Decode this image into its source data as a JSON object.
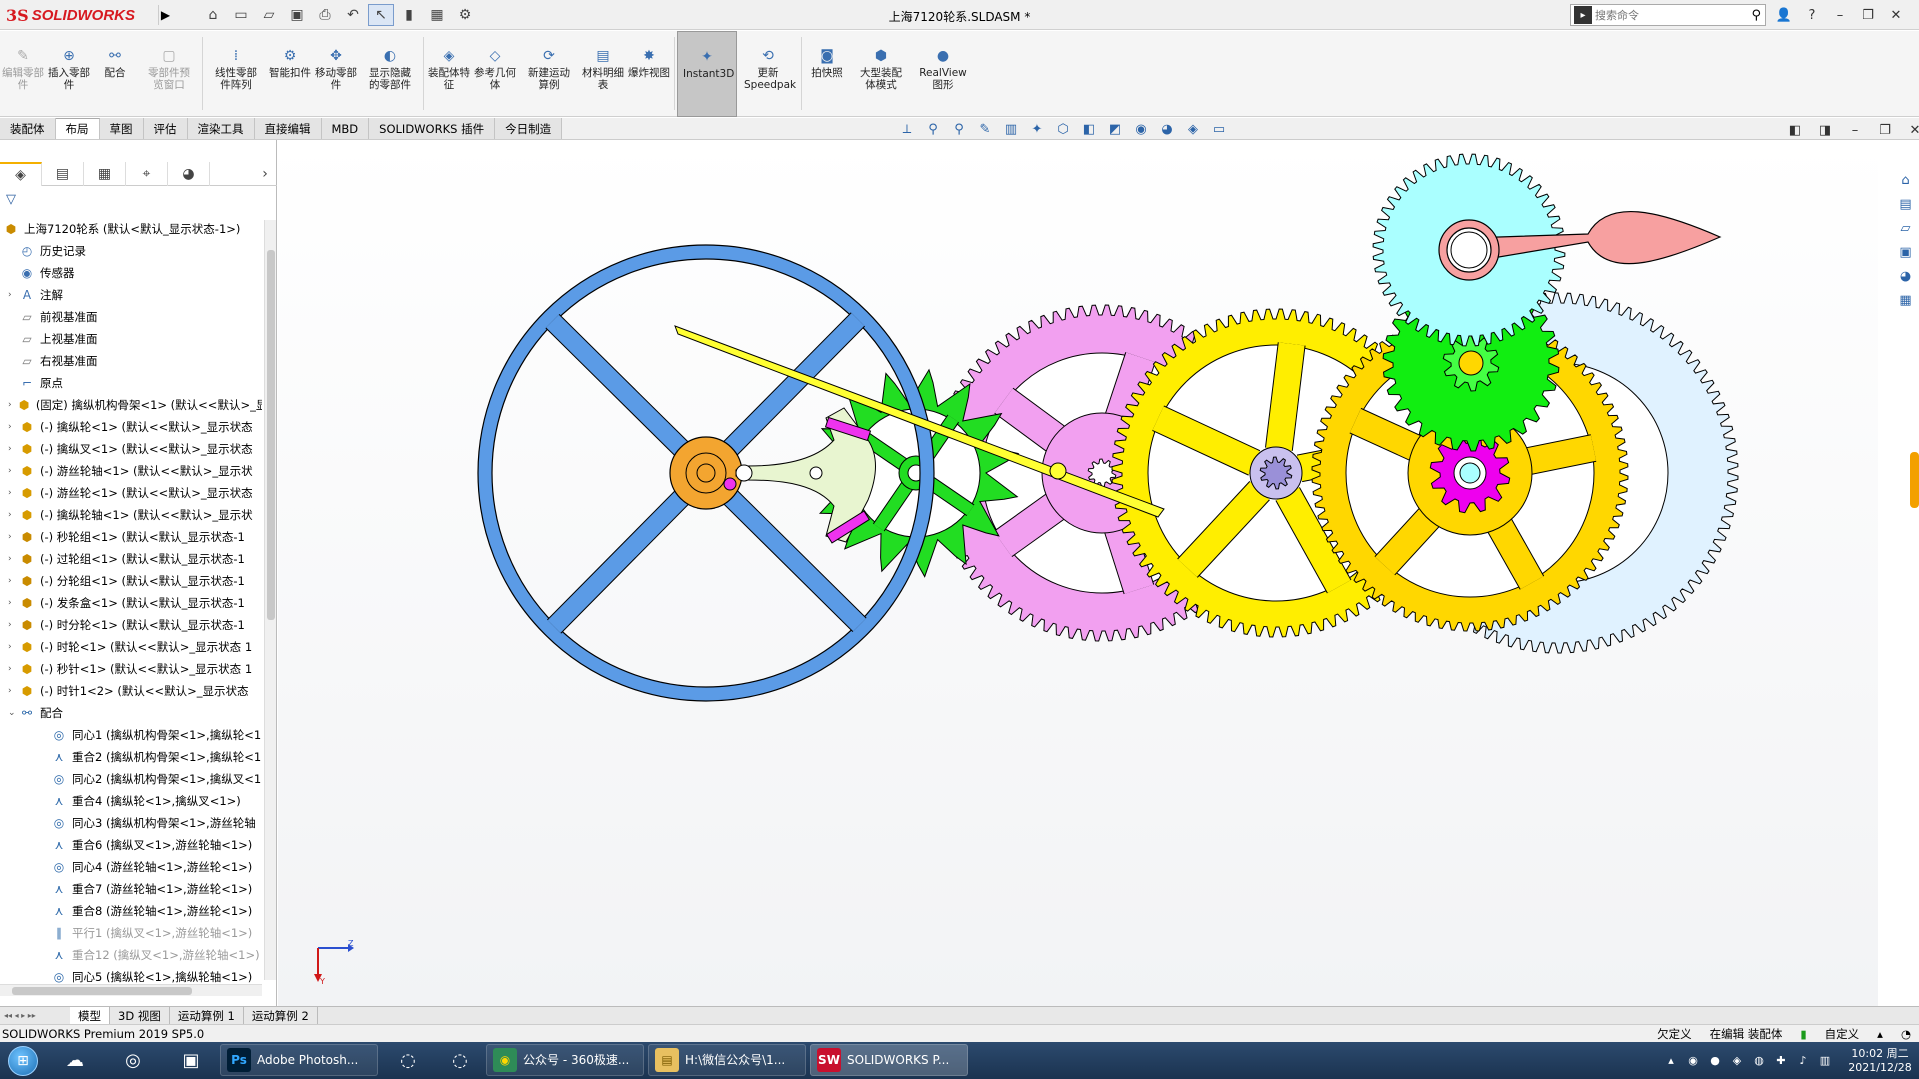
{
  "titlebar": {
    "logo_ds": "3S",
    "logo_text": "SOLIDWORKS",
    "document_title": "上海7120轮系.SLDASM *",
    "search_placeholder": "搜索命令"
  },
  "ribbon": {
    "buttons": [
      {
        "label": "编辑零部件",
        "disabled": true,
        "icon": "edit-component-icon"
      },
      {
        "label": "插入零部件",
        "disabled": false,
        "icon": "insert-component-icon"
      },
      {
        "label": "配合",
        "disabled": false,
        "icon": "mate-icon"
      },
      {
        "label": "零部件预览窗口",
        "disabled": true,
        "icon": "preview-window-icon"
      },
      {
        "label": "线性零部件阵列",
        "disabled": false,
        "icon": "linear-pattern-icon"
      },
      {
        "label": "智能扣件",
        "disabled": false,
        "icon": "smart-fastener-icon"
      },
      {
        "label": "移动零部件",
        "disabled": false,
        "icon": "move-component-icon"
      },
      {
        "label": "显示隐藏的零部件",
        "disabled": false,
        "icon": "show-hidden-icon"
      },
      {
        "label": "装配体特征",
        "disabled": false,
        "icon": "assembly-feature-icon"
      },
      {
        "label": "参考几何体",
        "disabled": false,
        "icon": "reference-geometry-icon"
      },
      {
        "label": "新建运动算例",
        "disabled": false,
        "icon": "new-motion-study-icon"
      },
      {
        "label": "材料明细表",
        "disabled": false,
        "icon": "bom-icon"
      },
      {
        "label": "爆炸视图",
        "disabled": false,
        "icon": "exploded-view-icon"
      },
      {
        "label": "Instant3D",
        "disabled": false,
        "icon": "instant3d-icon",
        "active": true
      },
      {
        "label": "更新Speedpak",
        "disabled": false,
        "icon": "speedpak-icon"
      },
      {
        "label": "拍快照",
        "disabled": false,
        "icon": "snapshot-icon"
      },
      {
        "label": "大型装配体模式",
        "disabled": false,
        "icon": "large-assembly-icon"
      },
      {
        "label": "RealView图形",
        "disabled": false,
        "icon": "realview-icon"
      }
    ]
  },
  "command_tabs": [
    {
      "label": "装配体",
      "active": false
    },
    {
      "label": "布局",
      "active": true
    },
    {
      "label": "草图",
      "active": false
    },
    {
      "label": "评估",
      "active": false
    },
    {
      "label": "渲染工具",
      "active": false
    },
    {
      "label": "直接编辑",
      "active": false
    },
    {
      "label": "MBD",
      "active": false
    },
    {
      "label": "SOLIDWORKS 插件",
      "active": false
    },
    {
      "label": "今日制造",
      "active": false
    }
  ],
  "tree": {
    "root": "上海7120轮系  (默认<默认_显示状态-1>)",
    "items": [
      {
        "label": "历史记录",
        "icon": "history-icon",
        "expand": ""
      },
      {
        "label": "传感器",
        "icon": "sensor-icon",
        "expand": ""
      },
      {
        "label": "注解",
        "icon": "annotation-icon",
        "expand": "›"
      },
      {
        "label": "前视基准面",
        "icon": "plane-icon",
        "expand": ""
      },
      {
        "label": "上视基准面",
        "icon": "plane-icon",
        "expand": ""
      },
      {
        "label": "右视基准面",
        "icon": "plane-icon",
        "expand": ""
      },
      {
        "label": "原点",
        "icon": "origin-icon",
        "expand": ""
      },
      {
        "label": "(固定) 擒纵机构骨架<1> (默认<<默认>_显示状态",
        "icon": "part-icon",
        "expand": "›"
      },
      {
        "label": "(-) 擒纵轮<1> (默认<<默认>_显示状态",
        "icon": "part-icon",
        "expand": "›"
      },
      {
        "label": "(-) 擒纵叉<1> (默认<<默认>_显示状态",
        "icon": "part-icon",
        "expand": "›"
      },
      {
        "label": "(-) 游丝轮轴<1> (默认<<默认>_显示状",
        "icon": "part-icon",
        "expand": "›"
      },
      {
        "label": "(-) 游丝轮<1> (默认<<默认>_显示状态",
        "icon": "part-icon",
        "expand": "›"
      },
      {
        "label": "(-) 擒纵轮轴<1> (默认<<默认>_显示状",
        "icon": "part-icon",
        "expand": "›"
      },
      {
        "label": "(-) 秒轮组<1> (默认<默认_显示状态-1",
        "icon": "assembly-icon",
        "expand": "›"
      },
      {
        "label": "(-) 过轮组<1> (默认<默认_显示状态-1",
        "icon": "assembly-icon",
        "expand": "›"
      },
      {
        "label": "(-) 分轮组<1> (默认<默认_显示状态-1",
        "icon": "assembly-icon",
        "expand": "›"
      },
      {
        "label": "(-) 发条盒<1> (默认<默认_显示状态-1",
        "icon": "assembly-icon",
        "expand": "›"
      },
      {
        "label": "(-) 时分轮<1> (默认<默认_显示状态-1",
        "icon": "assembly-icon",
        "expand": "›"
      },
      {
        "label": "(-) 时轮<1> (默认<<默认>_显示状态 1",
        "icon": "part-icon",
        "expand": "›"
      },
      {
        "label": "(-) 秒针<1> (默认<<默认>_显示状态 1",
        "icon": "part-icon",
        "expand": "›"
      },
      {
        "label": "(-) 时针1<2> (默认<<默认>_显示状态",
        "icon": "part-icon",
        "expand": "›"
      },
      {
        "label": "配合",
        "icon": "mates-folder-icon",
        "expand": "⌄"
      }
    ],
    "mates": [
      {
        "label": "同心1 (擒纵机构骨架<1>,擒纵轮<1",
        "icon": "concentric-icon",
        "grey": false
      },
      {
        "label": "重合2 (擒纵机构骨架<1>,擒纵轮<1",
        "icon": "coincident-icon",
        "grey": false
      },
      {
        "label": "同心2 (擒纵机构骨架<1>,擒纵叉<1",
        "icon": "concentric-icon",
        "grey": false
      },
      {
        "label": "重合4 (擒纵轮<1>,擒纵叉<1>)",
        "icon": "coincident-icon",
        "grey": false
      },
      {
        "label": "同心3 (擒纵机构骨架<1>,游丝轮轴",
        "icon": "concentric-icon",
        "grey": false
      },
      {
        "label": "重合6 (擒纵叉<1>,游丝轮轴<1>)",
        "icon": "coincident-icon",
        "grey": false
      },
      {
        "label": "同心4 (游丝轮轴<1>,游丝轮<1>)",
        "icon": "concentric-icon",
        "grey": false
      },
      {
        "label": "重合7 (游丝轮轴<1>,游丝轮<1>)",
        "icon": "coincident-icon",
        "grey": false
      },
      {
        "label": "重合8 (游丝轮轴<1>,游丝轮<1>)",
        "icon": "coincident-icon",
        "grey": false
      },
      {
        "label": "平行1 (擒纵叉<1>,游丝轮轴<1>)",
        "icon": "parallel-icon",
        "grey": true
      },
      {
        "label": "重合12 (擒纵叉<1>,游丝轮轴<1>)",
        "icon": "coincident-icon",
        "grey": true
      },
      {
        "label": "同心5 (擒纵轮<1>,擒纵轮轴<1>)",
        "icon": "concentric-icon",
        "grey": false
      }
    ]
  },
  "triad": {
    "z_label": "Z",
    "y_label": "Y"
  },
  "bottom_tabs": [
    {
      "label": "模型",
      "active": true
    },
    {
      "label": "3D 视图",
      "active": false
    },
    {
      "label": "运动算例 1",
      "active": false
    },
    {
      "label": "运动算例 2",
      "active": false
    }
  ],
  "status": {
    "left": "SOLIDWORKS Premium 2019 SP5.0",
    "under_defined": "欠定义",
    "editing": "在编辑 装配体",
    "custom": "自定义"
  },
  "taskbar": {
    "apps": [
      {
        "label": "Adobe Photosh...",
        "icon": "Ps",
        "color": "#001e36",
        "fg": "#31a8ff"
      },
      {
        "label": "公众号 - 360极速...",
        "icon": "◉",
        "color": "#2e8b57",
        "fg": "#ffd700"
      },
      {
        "label": "H:\\微信公众号\\1...",
        "icon": "▤",
        "color": "#e8c060",
        "fg": "#7a5a00"
      },
      {
        "label": "SOLIDWORKS P...",
        "icon": "SW",
        "color": "#c8102e",
        "fg": "#ffffff"
      }
    ],
    "clock_time": "10:02 周二",
    "clock_date": "2021/12/28"
  },
  "colors": {
    "balance_wheel": "#5b9be6",
    "escape_wheel": "#22dd22",
    "pallet_fork": "#e8f5d0",
    "pink_wheel": "#f2a0f0",
    "yellow_wheel": "#ffee00",
    "gold_wheel": "#ffd700",
    "green_wheel": "#11ee11",
    "cyan_wheel": "#aaffff",
    "light_blue_wheel": "#e0f2ff",
    "hand": "#f7a0a0",
    "magenta_pinion": "#ee00ee"
  }
}
